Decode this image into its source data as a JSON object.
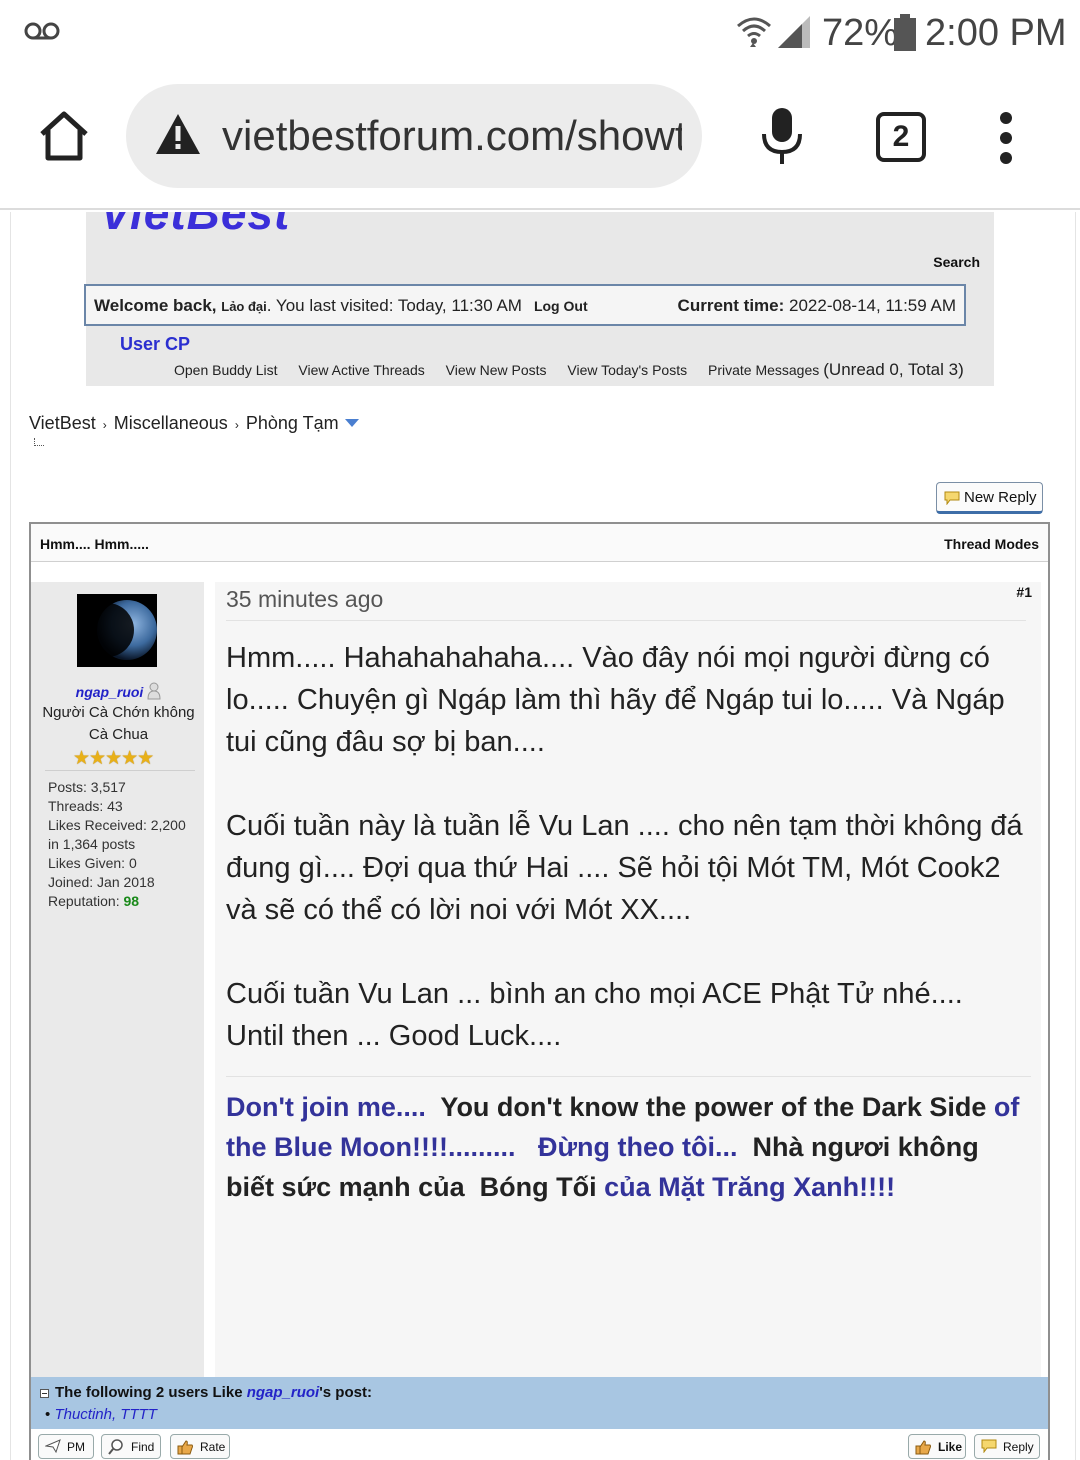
{
  "status_bar": {
    "battery": "72%",
    "time": "2:00 PM"
  },
  "browser": {
    "url": "vietbestforum.com/showthread",
    "tab_count": "2"
  },
  "header": {
    "logo": "VietBest",
    "search": "Search",
    "welcome_prefix": "Welcome back,",
    "username": "Lảo đại",
    "last_visited": ". You last visited: Today, 11:30 AM",
    "logout": "Log Out",
    "current_time_label": "Current time:",
    "current_time": "2022-08-14, 11:59 AM",
    "user_cp": "User CP",
    "nav": [
      "Open Buddy List",
      "View Active Threads",
      "View New Posts",
      "View Today's Posts",
      "Private Messages"
    ],
    "pm_count": "(Unread 0, Total 3)"
  },
  "breadcrumb": {
    "items": [
      "VietBest",
      "Miscellaneous",
      "Phòng Tạm"
    ],
    "separator": "›"
  },
  "new_reply": "New Reply",
  "thread": {
    "title": "Hmm.... Hmm.....",
    "modes": "Thread Modes"
  },
  "user": {
    "name": "ngap_ruoi",
    "title": "Người Cà Chớn không Cà Chua",
    "stars": "★★★★★",
    "stats": [
      {
        "label": "Posts: ",
        "value": "3,517"
      },
      {
        "label": "Threads: ",
        "value": "43"
      },
      {
        "label": "Likes Received: ",
        "value": "2,200"
      },
      {
        "label": "in ",
        "value": "1,364 posts"
      },
      {
        "label": "Likes Given: ",
        "value": "0"
      },
      {
        "label": "Joined: ",
        "value": "Jan 2018"
      }
    ],
    "reputation_label": "Reputation: ",
    "reputation": "98"
  },
  "post": {
    "date": "35 minutes ago",
    "number": "#1",
    "paragraphs": [
      "Hmm..... Hahahahahaha.... Vào đây nói mọi người đừng có lo..... Chuyện gì Ngáp làm thì hãy để Ngáp tui lo..... Và Ngáp tui cũng đâu sợ bị ban....",
      "Cuối tuần này là tuần lễ Vu Lan .... cho nên tạm thời không đá đung gì.... Đợi qua thứ Hai .... Sẽ hỏi tội Mót TM, Mót Cook2 và sẽ có thể có lời noi với Mót XX....",
      "Cuối tuần Vu Lan ... bình an cho mọi ACE Phật Tử nhé.... Until then ... Good Luck...."
    ],
    "signature": {
      "s1": "Don't join me....",
      "s2": "  You don't know the power of the Dark Side ",
      "s3": "of the Blue Moon!!!!.........",
      "s4": "   Đừng theo tôi...",
      "s5": "  Nhà ngươi không biết sức mạnh của  Bóng Tối ",
      "s6": "của Mặt Trăng Xanh!!!!"
    }
  },
  "likes": {
    "prefix": "The following 2 users Like ",
    "user": "ngap_ruoi",
    "suffix": "'s post:",
    "bullet": "•",
    "users": "Thuctinh, TTTT"
  },
  "buttons": {
    "pm": "PM",
    "find": "Find",
    "rate": "Rate",
    "like": "Like",
    "reply": "Reply"
  }
}
